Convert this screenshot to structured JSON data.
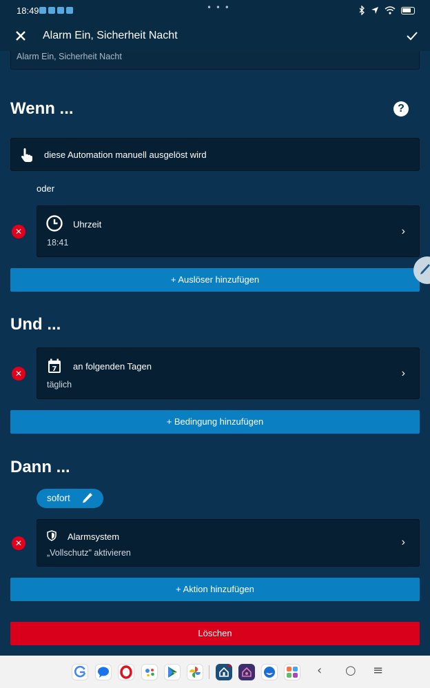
{
  "status_bar": {
    "time": "18:49",
    "icons": [
      "bluetooth-icon",
      "location-icon",
      "wifi-icon",
      "battery-icon"
    ]
  },
  "app_bar": {
    "title": "Alarm Ein, Sicherheit Nacht"
  },
  "name_field": {
    "value": "Alarm Ein, Sicherheit Nacht"
  },
  "wenn": {
    "title": "Wenn ...",
    "manual_trigger": "diese Automation manuell ausgelöst wird",
    "or_label": "oder",
    "trigger_card": {
      "title": "Uhrzeit",
      "subtitle": "18:41",
      "icon": "clock-icon"
    },
    "add_button": "+ Auslöser hinzufügen"
  },
  "und": {
    "title": "Und ...",
    "condition_card": {
      "title": "an folgenden Tagen",
      "subtitle": "täglich",
      "icon": "calendar-icon",
      "calendar_day": "7"
    },
    "add_button": "+ Bedingung hinzufügen"
  },
  "dann": {
    "title": "Dann ...",
    "timing_pill": "sofort",
    "action_card": {
      "title": "Alarmsystem",
      "subtitle": "„Vollschutz\" aktivieren",
      "icon": "shield-icon"
    },
    "add_button": "+ Aktion hinzufügen"
  },
  "delete_button": "Löschen",
  "nav_bar": {
    "apps": [
      "google-icon",
      "messages-icon",
      "opera-icon",
      "assistant-icon",
      "play-store-icon",
      "photos-icon",
      "bosch-smart-home-icon",
      "bosch-alarm-icon",
      "thunderbird-icon",
      "apps-drawer-icon"
    ]
  },
  "colors": {
    "background": "#0b3250",
    "card": "#071f33",
    "primary": "#0a7fc1",
    "danger": "#d8001a"
  }
}
